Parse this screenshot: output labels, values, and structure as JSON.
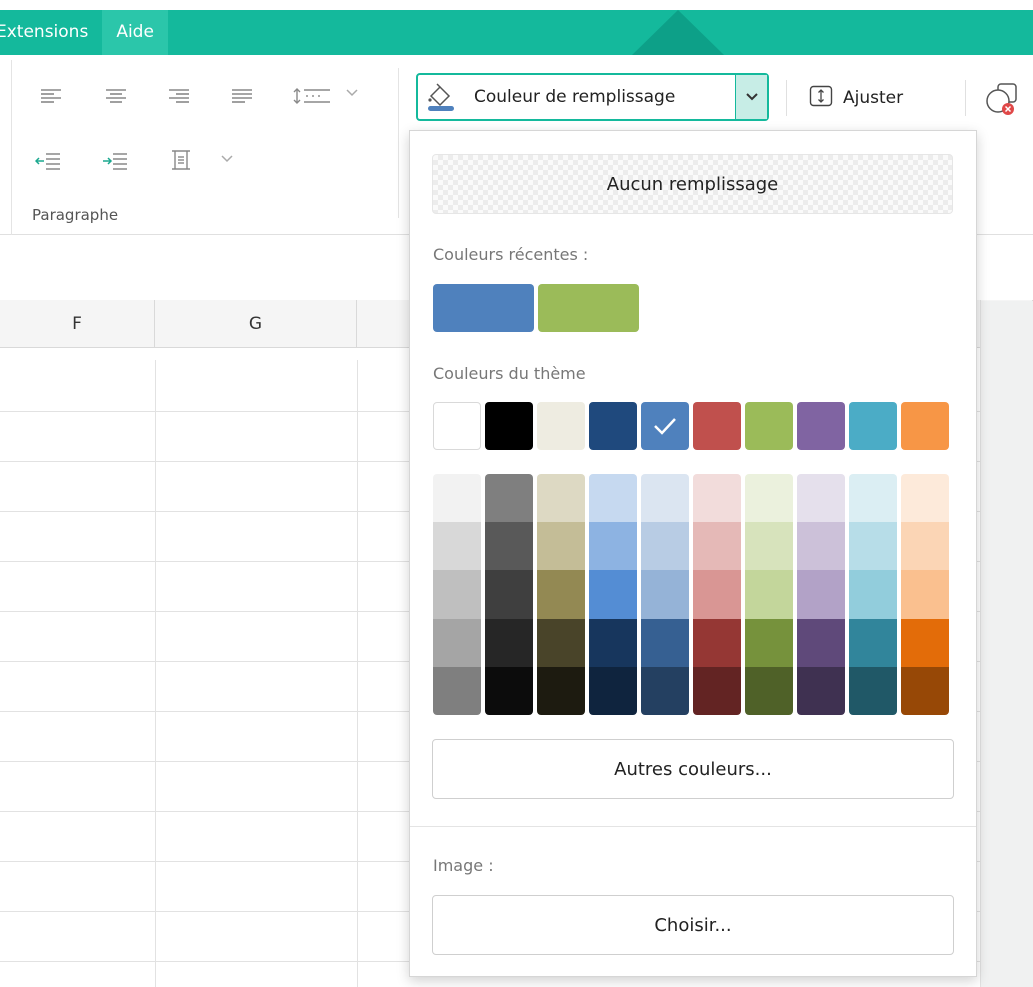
{
  "menubar": {
    "items": [
      {
        "label": "Extensions"
      },
      {
        "label": "Aide"
      }
    ]
  },
  "ribbon": {
    "paragraph_group_label": "Paragraphe",
    "fill_button_label": "Couleur de remplissage",
    "adjust_button_label": "Ajuster",
    "accent_color": "#14b99c"
  },
  "grid": {
    "columns": [
      "F",
      "G"
    ]
  },
  "fill_dropdown": {
    "no_fill_label": "Aucun remplissage",
    "recent_label": "Couleurs récentes :",
    "recent_colors": [
      "#4f81bd",
      "#9bbb59"
    ],
    "theme_label": "Couleurs du thème",
    "theme_colors": [
      "#ffffff",
      "#000000",
      "#eeece1",
      "#1f497d",
      "#4f81bd",
      "#c0504d",
      "#9bbb59",
      "#8064a2",
      "#4bacc6",
      "#f79646"
    ],
    "selected_theme_color": "#4f81bd",
    "shades": [
      [
        "#f2f2f2",
        "#d8d8d8",
        "#bfbfbf",
        "#a5a5a5",
        "#7f7f7f"
      ],
      [
        "#7f7f7f",
        "#595959",
        "#3f3f3f",
        "#262626",
        "#0c0c0c"
      ],
      [
        "#ddd9c3",
        "#c4bd97",
        "#938953",
        "#494429",
        "#1d1b10"
      ],
      [
        "#c6d9f0",
        "#8db3e2",
        "#548dd4",
        "#17365d",
        "#0f243e"
      ],
      [
        "#dbe5f1",
        "#b8cce4",
        "#95b3d7",
        "#366092",
        "#244061"
      ],
      [
        "#f2dcdb",
        "#e5b9b7",
        "#d99694",
        "#953734",
        "#632423"
      ],
      [
        "#ebf1dd",
        "#d7e3bc",
        "#c3d69b",
        "#76923c",
        "#4f6128"
      ],
      [
        "#e5e0ec",
        "#ccc1d9",
        "#b2a2c7",
        "#5f497a",
        "#3f3151"
      ],
      [
        "#dbeef3",
        "#b7dde8",
        "#92cddc",
        "#31859b",
        "#205867"
      ],
      [
        "#fdeada",
        "#fbd5b5",
        "#fac08f",
        "#e36c09",
        "#974806"
      ]
    ],
    "more_colors_label": "Autres couleurs...",
    "image_label": "Image :",
    "choose_label": "Choisir..."
  }
}
